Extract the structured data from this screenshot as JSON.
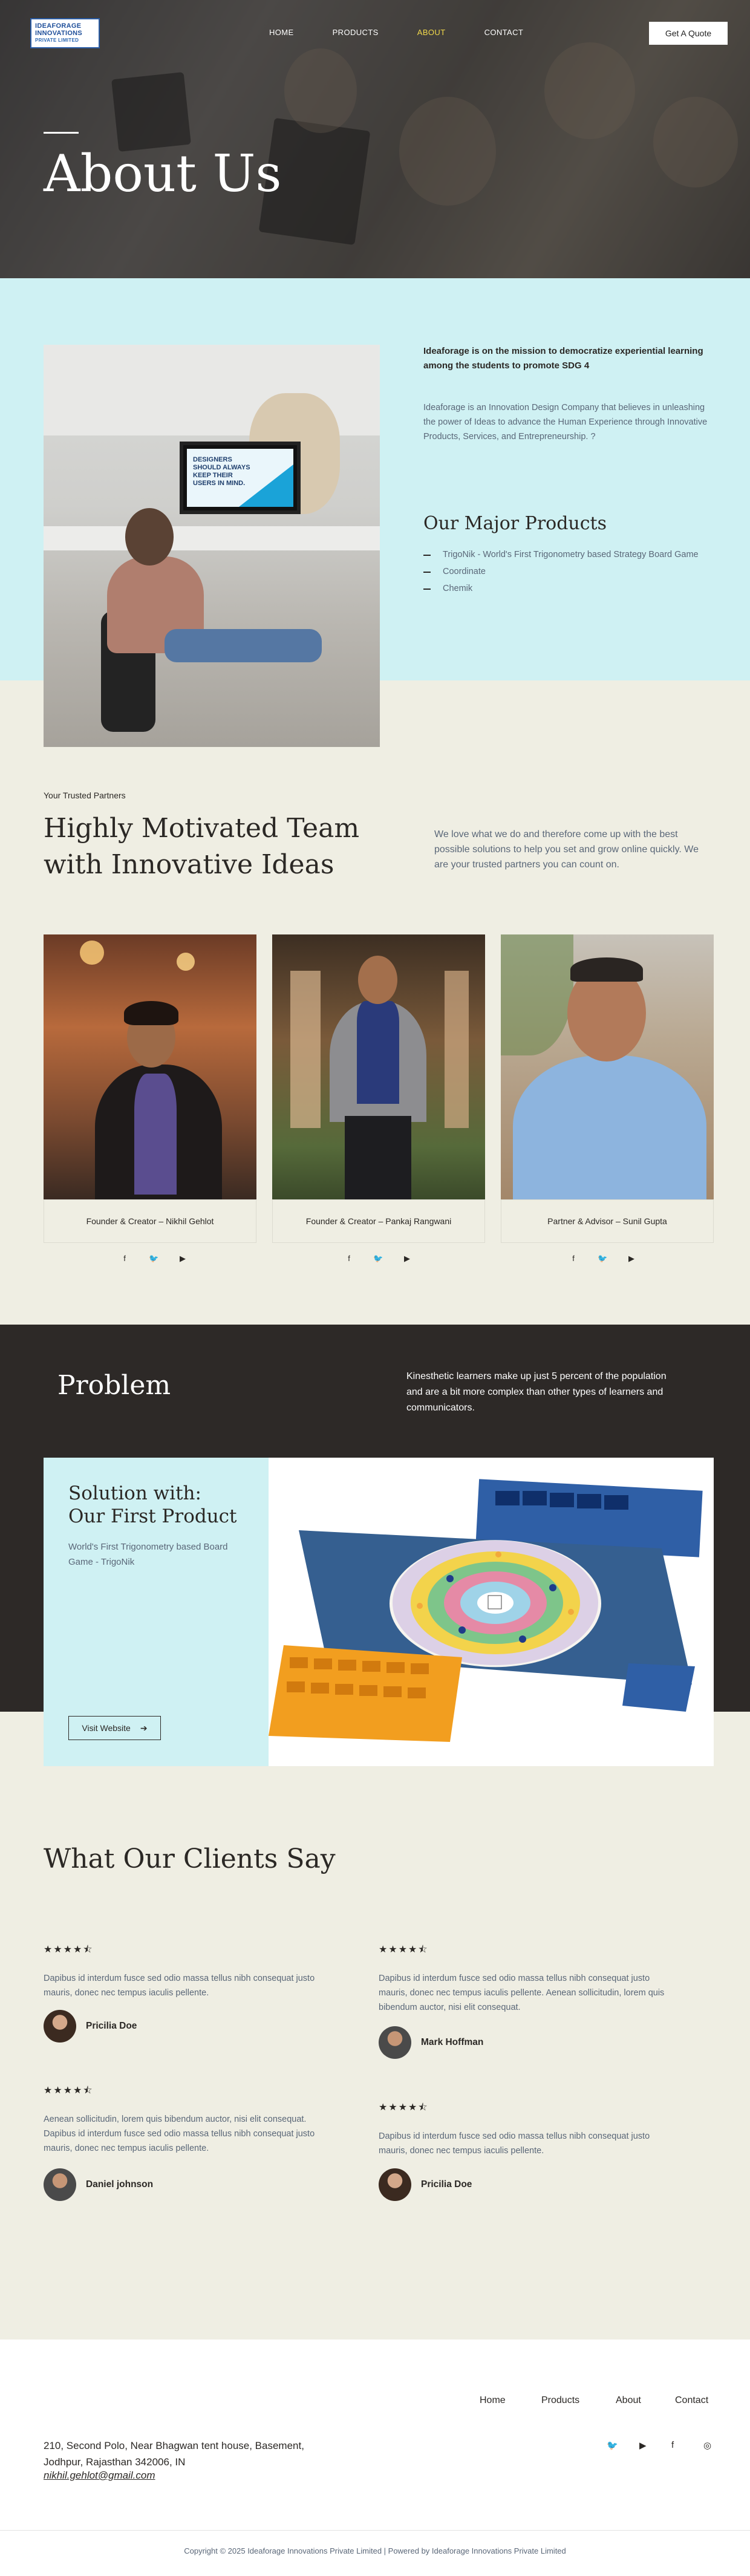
{
  "brand": {
    "logo_line1": "IDEAFORAGE",
    "logo_line2": "INNOVATIONS",
    "logo_line3": "PRIVATE LIMITED"
  },
  "nav": {
    "items": [
      "HOME",
      "PRODUCTS",
      "ABOUT",
      "CONTACT"
    ],
    "active": "ABOUT",
    "quote_button": "Get A Quote"
  },
  "hero": {
    "title": "About Us"
  },
  "about": {
    "image_text": "DESIGNERS SHOULD ALWAYS KEEP THEIR USERS IN MIND.",
    "mission": "Ideaforage is on the mission to democratize experiential learning among the students to promote SDG 4",
    "description": "Ideaforage is an Innovation Design Company that believes in unleashing the power of Ideas to advance the Human Experience through Innovative Products, Services, and Entrepreneurship. ?",
    "products_title": "Our Major Products",
    "products": [
      "TrigoNik - World's First Trigonometry based Strategy Board Game",
      "Coordinate",
      "Chemik"
    ]
  },
  "team": {
    "eyebrow": "Your Trusted Partners",
    "title": "Highly Motivated Team with Innovative Ideas",
    "description": "We love what we do and therefore come up with the best possible solutions to help you set and grow online quickly. We are your trusted partners you can count on.",
    "members": [
      {
        "name": "Founder & Creator – Nikhil Gehlot"
      },
      {
        "name": "Founder & Creator – Pankaj Rangwani"
      },
      {
        "name": "Partner & Advisor – Sunil Gupta"
      }
    ]
  },
  "problem": {
    "title": "Problem",
    "description": "Kinesthetic learners make up just 5 percent of the population and are a bit more complex than other types of learners and communicators."
  },
  "solution": {
    "title_line1": "Solution with:",
    "title_line2": "Our First Product",
    "description": "World's First Trigonometry based Board Game - TrigoNik",
    "button": "Visit Website"
  },
  "testimonials": {
    "title": "What Our Clients Say",
    "items": [
      {
        "text": "Dapibus id interdum fusce sed odio massa tellus nibh consequat justo mauris, donec nec tempus iaculis pellente.",
        "name": "Pricilia Doe",
        "rating": 4.5
      },
      {
        "text": "Dapibus id interdum fusce sed odio massa tellus nibh consequat justo mauris, donec nec tempus iaculis pellente. Aenean sollicitudin, lorem quis bibendum auctor, nisi elit consequat.",
        "name": "Mark Hoffman",
        "rating": 4.5
      },
      {
        "text": "Aenean sollicitudin, lorem quis bibendum auctor, nisi elit consequat. Dapibus id interdum fusce sed odio massa tellus nibh consequat justo mauris, donec nec tempus iaculis pellente.",
        "name": "Daniel johnson",
        "rating": 4.5
      },
      {
        "text": "Dapibus id interdum fusce sed odio massa tellus nibh consequat justo mauris, donec nec tempus iaculis pellente.",
        "name": "Pricilia Doe",
        "rating": 4.5
      }
    ]
  },
  "footer": {
    "nav": [
      "Home",
      "Products",
      "About",
      "Contact"
    ],
    "address_line1": "210, Second Polo, Near Bhagwan tent house, Basement,",
    "address_line2": "Jodhpur, Rajasthan 342006, IN",
    "email": "nikhil.gehlot@gmail.com",
    "social_icons": [
      "twitter-icon",
      "youtube-icon",
      "facebook-icon",
      "instagram-icon"
    ],
    "copyright": "Copyright © 2025 Ideaforage Innovations Private Limited | Powered by Ideaforage Innovations Private Limited"
  },
  "colors": {
    "accent_cyan": "#cff1f3",
    "dark": "#2d2927",
    "cream": "#efeee3",
    "nav_active": "#f2d94b",
    "text_muted": "#5a6778"
  }
}
